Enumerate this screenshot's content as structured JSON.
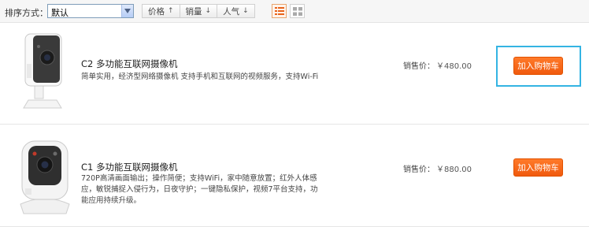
{
  "toolbar": {
    "sort_label": "排序方式：",
    "sort_select_value": "默认",
    "sort_buttons": [
      {
        "label": "价格",
        "arrow": "↑"
      },
      {
        "label": "销量",
        "arrow": "↓"
      },
      {
        "label": "人气",
        "arrow": "↓"
      }
    ],
    "view_modes": [
      {
        "icon": "list-view-icon",
        "active": true
      },
      {
        "icon": "grid-view-icon",
        "active": false
      }
    ]
  },
  "products": [
    {
      "title": "C2 多功能互联网摄像机",
      "description": "简单实用，经济型网络摄像机 支持手机和互联网的视频服务，支持Wi-Fi",
      "price_label": "销售价：",
      "price": "￥480.00",
      "cart_label": "加入购物车",
      "image": "camera-c2-image"
    },
    {
      "title": "C1 多功能互联网摄像机",
      "description": "720P高清画面输出；操作简便；支持WiFi，家中随意放置；红外人体感应，敏锐捕捉入侵行为，日夜守护；一键隐私保护，视频7平台支持，功能应用持续升级。",
      "price_label": "销售价：",
      "price": "￥880.00",
      "cart_label": "加入购物车",
      "image": "camera-c1-image"
    }
  ],
  "colors": {
    "accent": "#f26a18",
    "focus_outline": "#34b4e3"
  }
}
